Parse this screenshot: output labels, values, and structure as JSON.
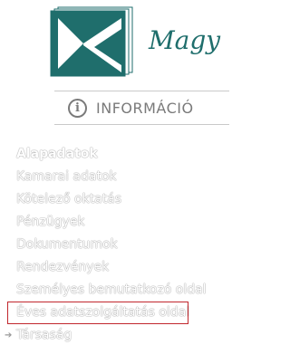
{
  "header": {
    "brand_text": "Magy"
  },
  "info": {
    "label": "INFORMÁCIÓ"
  },
  "menu": {
    "title": "Alapadatok",
    "items": [
      {
        "label": "Kamarai adatok"
      },
      {
        "label": "Kötelező oktatás"
      },
      {
        "label": "Pénzügyek"
      },
      {
        "label": "Dokumentumok"
      },
      {
        "label": "Rendezvények"
      },
      {
        "label": "Személyes bemutatkozó oldal"
      },
      {
        "label": "Éves adatszolgáltatás oldal"
      },
      {
        "label": "Társaság"
      }
    ]
  },
  "colors": {
    "brand": "#1f6e6c",
    "highlight_border": "#c1272d",
    "muted": "#7a7a7a"
  }
}
